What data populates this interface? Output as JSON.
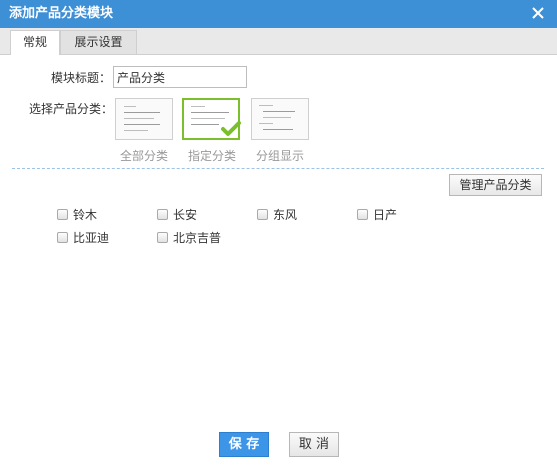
{
  "dialog": {
    "title": "添加产品分类模块",
    "close_icon": "close-icon"
  },
  "tabs": [
    {
      "label": "常规",
      "active": true
    },
    {
      "label": "展示设置",
      "active": false
    }
  ],
  "form": {
    "module_title_label": "模块标题：",
    "module_title_value": "产品分类",
    "select_label": "选择产品分类：",
    "options": [
      {
        "label": "全部分类",
        "selected": false
      },
      {
        "label": "指定分类",
        "selected": true
      },
      {
        "label": "分组显示",
        "selected": false
      }
    ],
    "manage_button": "管理产品分类"
  },
  "categories": [
    {
      "label": "铃木",
      "checked": false
    },
    {
      "label": "长安",
      "checked": false
    },
    {
      "label": "东风",
      "checked": false
    },
    {
      "label": "日产",
      "checked": false
    },
    {
      "label": "比亚迪",
      "checked": false
    },
    {
      "label": "北京吉普",
      "checked": false
    }
  ],
  "footer": {
    "save": "保 存",
    "cancel": "取 消"
  },
  "colors": {
    "title_bar": "#3d8fd6",
    "selected_border": "#7bbf2c",
    "save_button": "#3d95e8"
  }
}
